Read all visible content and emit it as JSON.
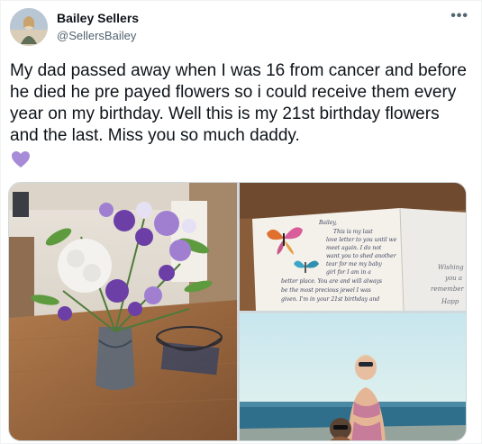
{
  "user": {
    "name": "Bailey Sellers",
    "handle": "@SellersBailey"
  },
  "more_glyph": "•••",
  "tweet": {
    "text": "My dad passed away when I was 16 from cancer and before he died he pre payed flowers so i could receive them every year on my birthday. Well this is my 21st birthday flowers and the last. Miss you so much daddy."
  },
  "emoji": {
    "icon": "purple-heart-icon",
    "color": "#a78bd8"
  },
  "media": {
    "card_lines": [
      "Bailey,",
      "This is my last",
      "love letter to you until we",
      "meet again. I do not",
      "want you to shed another",
      "tear for me my baby",
      "girl for I am in a",
      "better place. You are and will always",
      "be the most precious jewel I was",
      "given. I'm in your 21st birthday and"
    ],
    "card_right_lines": [
      "Wishing",
      "you a",
      "remember",
      "Happ"
    ]
  },
  "colors": {
    "text": "#0f1419",
    "secondary": "#536471",
    "border": "#cfd9de"
  }
}
